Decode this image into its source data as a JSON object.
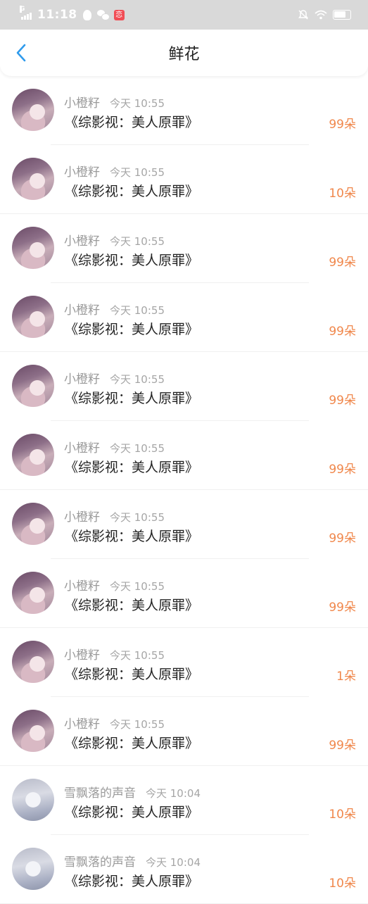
{
  "status_bar": {
    "time": "11:18",
    "network": "G",
    "app_badge": "恋",
    "colors": {
      "background": "#d9d9d9",
      "foreground": "#ffffff"
    }
  },
  "header": {
    "title": "鲜花",
    "back_icon": "chevron-left-icon",
    "accent": "#2f9bec"
  },
  "items": [
    {
      "user": "小橙籽",
      "time": "今天 10:55",
      "book": "《综影视：美人原罪》",
      "amount": "99朵",
      "avatar": "a1"
    },
    {
      "user": "小橙籽",
      "time": "今天 10:55",
      "book": "《综影视：美人原罪》",
      "amount": "10朵",
      "avatar": "a1"
    },
    {
      "user": "小橙籽",
      "time": "今天 10:55",
      "book": "《综影视：美人原罪》",
      "amount": "99朵",
      "avatar": "a1"
    },
    {
      "user": "小橙籽",
      "time": "今天 10:55",
      "book": "《综影视：美人原罪》",
      "amount": "99朵",
      "avatar": "a1"
    },
    {
      "user": "小橙籽",
      "time": "今天 10:55",
      "book": "《综影视：美人原罪》",
      "amount": "99朵",
      "avatar": "a1"
    },
    {
      "user": "小橙籽",
      "time": "今天 10:55",
      "book": "《综影视：美人原罪》",
      "amount": "99朵",
      "avatar": "a1"
    },
    {
      "user": "小橙籽",
      "time": "今天 10:55",
      "book": "《综影视：美人原罪》",
      "amount": "99朵",
      "avatar": "a1"
    },
    {
      "user": "小橙籽",
      "time": "今天 10:55",
      "book": "《综影视：美人原罪》",
      "amount": "99朵",
      "avatar": "a1"
    },
    {
      "user": "小橙籽",
      "time": "今天 10:55",
      "book": "《综影视：美人原罪》",
      "amount": "1朵",
      "avatar": "a1"
    },
    {
      "user": "小橙籽",
      "time": "今天 10:55",
      "book": "《综影视：美人原罪》",
      "amount": "99朵",
      "avatar": "a1"
    },
    {
      "user": "雪飘落的声音",
      "time": "今天 10:04",
      "book": "《综影视：美人原罪》",
      "amount": "10朵",
      "avatar": "a2"
    },
    {
      "user": "雪飘落的声音",
      "time": "今天 10:04",
      "book": "《综影视：美人原罪》",
      "amount": "10朵",
      "avatar": "a2"
    }
  ],
  "colors": {
    "amount": "#f0874b",
    "name": "#9a9a9a",
    "title": "#222222"
  }
}
